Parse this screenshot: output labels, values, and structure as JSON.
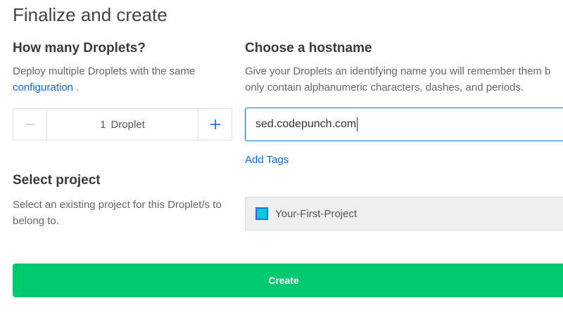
{
  "page": {
    "title": "Finalize and create"
  },
  "droplets": {
    "heading": "How many Droplets?",
    "description_line1": "Deploy multiple Droplets with the same",
    "description_link": "configuration",
    "description_end": " .",
    "count": "1",
    "unit": "Droplet",
    "minus_icon": "minus-icon",
    "plus_icon": "plus-icon"
  },
  "hostname": {
    "heading": "Choose a hostname",
    "description_line1": "Give your Droplets an identifying name you will remember them b",
    "description_line2": "only contain alphanumeric characters, dashes, and periods.",
    "value": "sed.codepunch.com",
    "add_tags": "Add Tags"
  },
  "project": {
    "heading": "Select project",
    "description_line1": "Select an existing project for this Droplet/s to",
    "description_line2": "belong to.",
    "selected": "Your-First-Project",
    "icon": "project-icon"
  },
  "create": {
    "label": "Create"
  },
  "colors": {
    "accent_blue": "#0069ff",
    "create_green": "#00c96f",
    "project_icon_fill": "#0fc6d6"
  }
}
